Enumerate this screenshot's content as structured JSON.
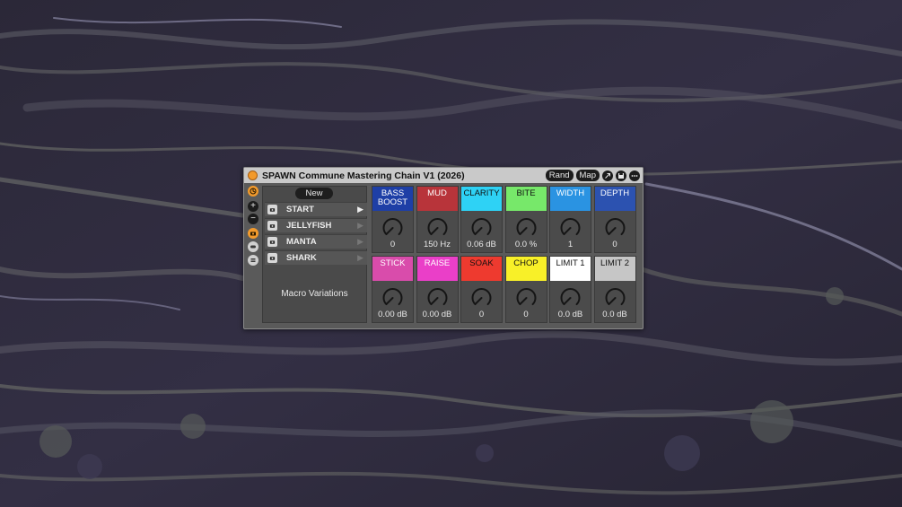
{
  "window": {
    "title": "SPAWN Commune Mastering Chain V1 (2026)",
    "rand_label": "Rand",
    "map_label": "Map",
    "icons": [
      "power-icon",
      "link-icon",
      "save-icon",
      "more-icon"
    ]
  },
  "rail": {
    "icons": [
      "compass-icon",
      "plus-icon",
      "minus-icon",
      "camera-icon",
      "toggle-icon",
      "list-icon"
    ],
    "plus_glyph": "+",
    "minus_glyph": "−"
  },
  "variations": {
    "new_label": "New",
    "items": [
      {
        "label": "START",
        "play": "▶"
      },
      {
        "label": "JELLYFISH",
        "play": "▶"
      },
      {
        "label": "MANTA",
        "play": "▶"
      },
      {
        "label": "SHARK",
        "play": "▶"
      }
    ],
    "title": "Macro Variations"
  },
  "macros": [
    {
      "label": "BASS BOOST",
      "value": "0",
      "color": "#1e3fa6",
      "text_color": "#ffffff",
      "level": 0.0
    },
    {
      "label": "MUD",
      "value": "150 Hz",
      "color": "#b8343a",
      "text_color": "#ffffff",
      "level": 0.0
    },
    {
      "label": "CLARITY",
      "value": "0.06 dB",
      "color": "#2ed2f5",
      "text_color": "#111111",
      "level": 0.0
    },
    {
      "label": "BITE",
      "value": "0.0 %",
      "color": "#77e86a",
      "text_color": "#111111",
      "level": 0.0
    },
    {
      "label": "WIDTH",
      "value": "1",
      "color": "#2a93e2",
      "text_color": "#ffffff",
      "level": 0.0
    },
    {
      "label": "DEPTH",
      "value": "0",
      "color": "#2c52b0",
      "text_color": "#ffffff",
      "level": 0.0
    },
    {
      "label": "STICK",
      "value": "0.00 dB",
      "color": "#d94cab",
      "text_color": "#ffffff",
      "level": 0.0
    },
    {
      "label": "RAISE",
      "value": "0.00 dB",
      "color": "#ea3fc8",
      "text_color": "#ffffff",
      "level": 0.0
    },
    {
      "label": "SOAK",
      "value": "0",
      "color": "#ee3a2f",
      "text_color": "#111111",
      "level": 0.0
    },
    {
      "label": "CHOP",
      "value": "0",
      "color": "#f8f028",
      "text_color": "#111111",
      "level": 0.0
    },
    {
      "label": "LIMIT 1",
      "value": "0.0 dB",
      "color": "#ffffff",
      "text_color": "#111111",
      "level": 0.0
    },
    {
      "label": "LIMIT 2",
      "value": "0.0 dB",
      "color": "#c6c6c6",
      "text_color": "#111111",
      "level": 0.0
    }
  ],
  "colors": {
    "accent": "#f29a2c",
    "panel": "#5a5a5a",
    "titlebar": "#c9c9c9"
  }
}
